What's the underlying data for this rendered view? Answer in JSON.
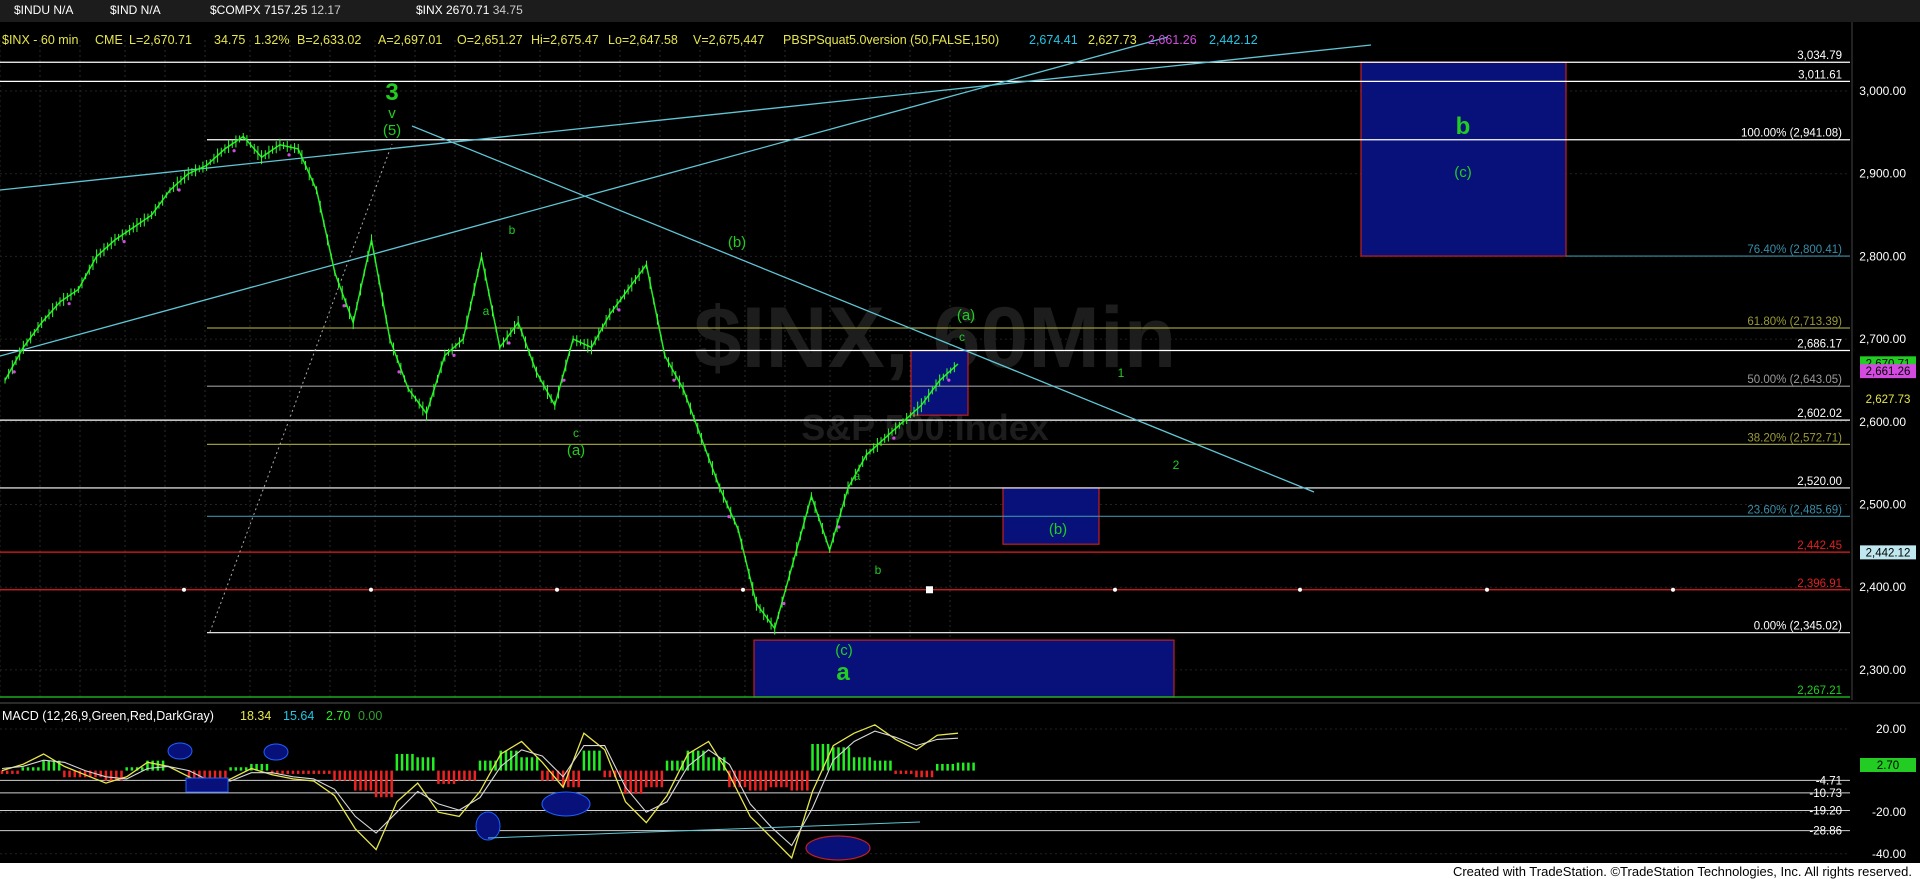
{
  "tabs": [
    {
      "symbol": "$INDU N/A",
      "value": ""
    },
    {
      "symbol": "$IND N/A",
      "value": ""
    },
    {
      "symbol": "$COMPX 7157.25",
      "value": "12.17"
    },
    {
      "symbol": "$INX 2670.71",
      "value": "34.75"
    }
  ],
  "header": {
    "symbol": "$INX - 60 min",
    "exchange": "CME",
    "last": "L=2,670.71",
    "change": "34.75",
    "pct": "1.32%",
    "bid": "B=2,633.02",
    "ask": "A=2,697.01",
    "open": "O=2,651.27",
    "high": "Hi=2,675.47",
    "low": "Lo=2,647.58",
    "volume": "V=2,675,447",
    "indicator": "PBSPSquat5.0version (50,FALSE,150)",
    "ind_values": [
      "2,674.41",
      "2,627.73",
      "2,661.26",
      "2,442.12"
    ],
    "ind_colors": [
      "#22c6e6",
      "#e6e64a",
      "#d44ae0",
      "#22c6e6"
    ]
  },
  "watermark": {
    "main": "$INX, 60Min",
    "sub": "S&P 500 Index"
  },
  "macd": {
    "label": "MACD (12,26,9,Green,Red,DarkGray)",
    "values": [
      "18.34",
      "15.64",
      "2.70",
      "0.00"
    ],
    "colors": [
      "#e6e64a",
      "#22c6e6",
      "#22ee22",
      "#2ea02e"
    ]
  },
  "footer": "Created with TradeStation. ©TradeStation Technologies, Inc. All rights reserved.",
  "chart_data": {
    "type": "line",
    "title": "$INX - 60 min",
    "price_axis": {
      "ticks": [
        3000,
        2900,
        2800,
        2700,
        2600,
        2500,
        2400,
        2300
      ],
      "tick_labels": [
        "3,000.00",
        "2,900.00",
        "2,800.00",
        "2,700.00",
        "2,600.00",
        "2,500.00",
        "2,400.00",
        "2,300.00"
      ],
      "range": [
        2245,
        3050
      ]
    },
    "price_series_approx": [
      2650,
      2690,
      2720,
      2745,
      2760,
      2800,
      2820,
      2835,
      2850,
      2880,
      2900,
      2910,
      2930,
      2945,
      2920,
      2935,
      2930,
      2880,
      2780,
      2720,
      2820,
      2700,
      2640,
      2610,
      2680,
      2700,
      2800,
      2690,
      2720,
      2660,
      2620,
      2700,
      2690,
      2730,
      2760,
      2790,
      2680,
      2640,
      2580,
      2520,
      2470,
      2380,
      2350,
      2430,
      2510,
      2445,
      2520,
      2560,
      2580,
      2600,
      2620,
      2650,
      2670
    ],
    "horizontal_levels": [
      {
        "value": 3034.79,
        "label": "3,034.79",
        "color": "#ffffff"
      },
      {
        "value": 3011.61,
        "label": "3,011.61",
        "color": "#ffffff"
      },
      {
        "value": 2941.08,
        "label": "100.00% (2,941.08)",
        "color": "#ffffff"
      },
      {
        "value": 2800.41,
        "label": "76.40% (2,800.41)",
        "color": "#3a8ea8"
      },
      {
        "value": 2713.39,
        "label": "61.80% (2,713.39)",
        "color": "#9a9a3a"
      },
      {
        "value": 2686.17,
        "label": "2,686.17",
        "color": "#ffffff"
      },
      {
        "value": 2643.05,
        "label": "50.00% (2,643.05)",
        "color": "#9a9a9a"
      },
      {
        "value": 2602.02,
        "label": "2,602.02",
        "color": "#ffffff"
      },
      {
        "value": 2572.71,
        "label": "38.20% (2,572.71)",
        "color": "#9a9a3a"
      },
      {
        "value": 2520.0,
        "label": "2,520.00",
        "color": "#ffffff"
      },
      {
        "value": 2485.69,
        "label": "23.60% (2,485.69)",
        "color": "#3a8ea8"
      },
      {
        "value": 2442.45,
        "label": "2,442.45",
        "color": "#e02020"
      },
      {
        "value": 2396.91,
        "label": "2,396.91",
        "color": "#e02020"
      },
      {
        "value": 2345.02,
        "label": "0.00% (2,345.02)",
        "color": "#ffffff"
      },
      {
        "value": 2267.21,
        "label": "2,267.21",
        "color": "#22cc22"
      }
    ],
    "price_tags": [
      {
        "value": 2670.71,
        "label": "2,670.71",
        "bg": "#22cc22",
        "fg": "#000000"
      },
      {
        "value": 2661.26,
        "label": "2,661.26",
        "bg": "#d44ae0",
        "fg": "#000000"
      },
      {
        "value": 2627.73,
        "label": "2,627.73",
        "bg": "#000000",
        "fg": "#e6e64a"
      },
      {
        "value": 2442.12,
        "label": "2,442.12",
        "bg": "#bfe7ef",
        "fg": "#000000"
      }
    ],
    "wave_labels": [
      {
        "text": "3",
        "color": "#22cc22",
        "size": "big"
      },
      {
        "text": "v",
        "color": "#22cc22",
        "size": "mid"
      },
      {
        "text": "(5)",
        "color": "#22cc22",
        "size": "mid"
      },
      {
        "text": "b",
        "color": "#22cc22",
        "size": "small"
      },
      {
        "text": "a",
        "color": "#22cc22",
        "size": "small"
      },
      {
        "text": "c",
        "color": "#22cc22",
        "size": "small"
      },
      {
        "text": "(a)",
        "color": "#22cc22",
        "size": "mid"
      },
      {
        "text": "(b)",
        "color": "#22cc22",
        "size": "mid"
      },
      {
        "text": "(a)",
        "color": "#22cc22",
        "size": "mid"
      },
      {
        "text": "c",
        "color": "#22cc22",
        "size": "small"
      },
      {
        "text": "1",
        "color": "#22cc22",
        "size": "small"
      },
      {
        "text": "2",
        "color": "#22cc22",
        "size": "small"
      },
      {
        "text": "a",
        "color": "#22cc22",
        "size": "small"
      },
      {
        "text": "b",
        "color": "#22cc22",
        "size": "small"
      },
      {
        "text": "(b)",
        "color": "#22cc22",
        "size": "mid"
      },
      {
        "text": "(c)",
        "color": "#22cc22",
        "size": "mid"
      },
      {
        "text": "a",
        "color": "#22cc22",
        "size": "big"
      },
      {
        "text": "b",
        "color": "#22cc22",
        "size": "big"
      },
      {
        "text": "(c)",
        "color": "#22cc22",
        "size": "mid"
      }
    ],
    "target_boxes": [
      {
        "name": "b-target-box",
        "price_top": 3034.79,
        "price_bottom": 2800.41,
        "fill": "#08107a"
      },
      {
        "name": "a-c-target-box",
        "price_top": 2686.17,
        "price_bottom": 2608,
        "fill": "#08107a"
      },
      {
        "name": "b-small-box",
        "price_top": 2520,
        "price_bottom": 2452,
        "fill": "#08107a"
      },
      {
        "name": "a-target-box",
        "price_top": 2336,
        "price_bottom": 2267.21,
        "fill": "#08107a"
      }
    ],
    "macd_axis": {
      "ticks": [
        20,
        -20,
        -40
      ],
      "tick_labels": [
        "20.00",
        "-20.00",
        "-40.00"
      ],
      "range": [
        -42,
        26
      ]
    },
    "macd_levels": [
      {
        "value": -4.71,
        "label": "-4.71"
      },
      {
        "value": -10.73,
        "label": "-10.73"
      },
      {
        "value": -19.2,
        "label": "-19.20"
      },
      {
        "value": -28.86,
        "label": "-28.86"
      }
    ],
    "macd_tag": {
      "value": 2.7,
      "label": "2.70",
      "bg": "#22cc22"
    },
    "macd_line_approx": [
      0,
      3,
      8,
      2,
      -2,
      -6,
      -3,
      4,
      2,
      -3,
      -8,
      -4,
      1,
      -2,
      -4,
      -5,
      -12,
      -28,
      -38,
      -15,
      -6,
      -20,
      -22,
      -10,
      8,
      14,
      4,
      -8,
      18,
      10,
      -15,
      -25,
      -12,
      8,
      14,
      -2,
      -22,
      -32,
      -42,
      -10,
      12,
      18,
      22,
      15,
      10,
      17,
      18
    ],
    "macd_signal_approx": [
      1,
      2,
      5,
      4,
      0,
      -3,
      -4,
      1,
      2,
      0,
      -5,
      -5,
      -1,
      -1,
      -3,
      -4,
      -9,
      -22,
      -30,
      -20,
      -10,
      -16,
      -19,
      -13,
      2,
      10,
      7,
      -3,
      12,
      12,
      -8,
      -20,
      -15,
      2,
      10,
      3,
      -16,
      -27,
      -36,
      -18,
      5,
      14,
      19,
      16,
      12,
      15,
      15.6
    ],
    "grid": true
  }
}
